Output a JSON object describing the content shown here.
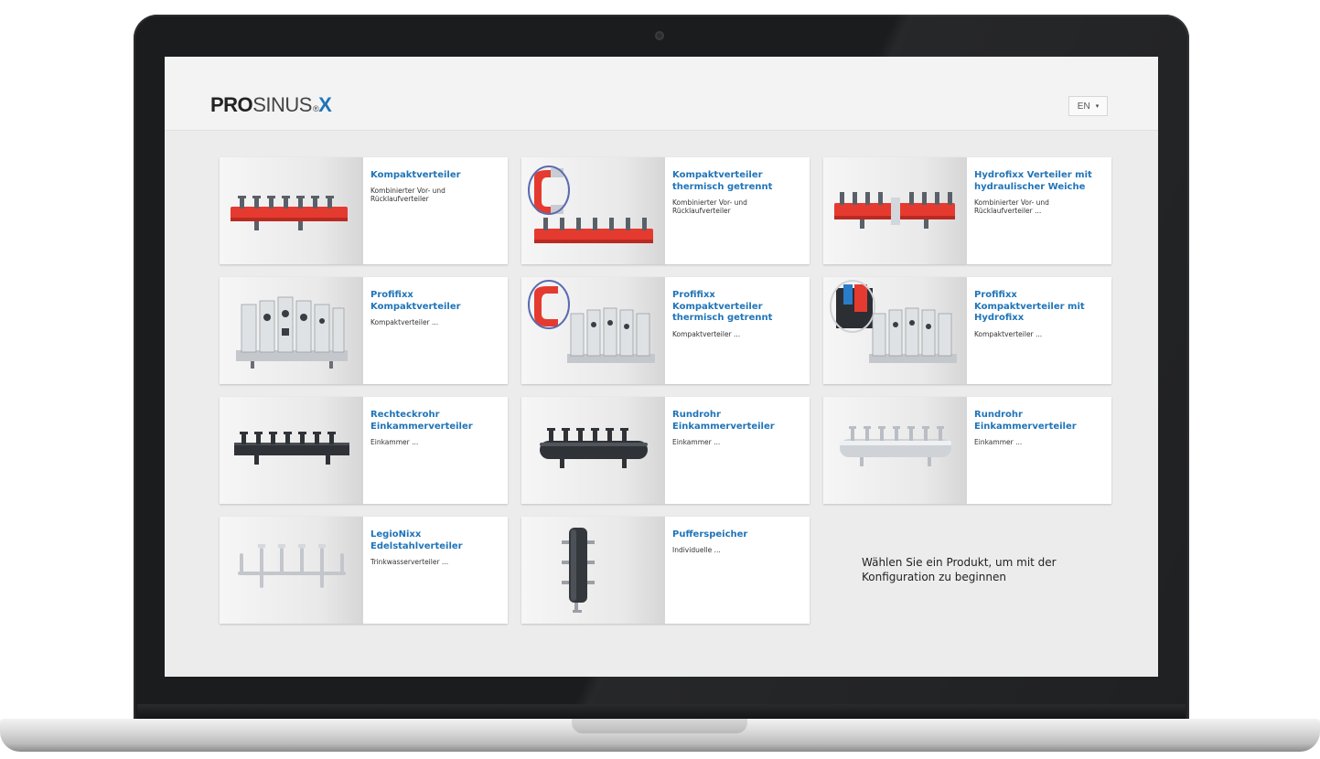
{
  "app": {
    "logo": {
      "part1": "PRO",
      "part2": "SINUS",
      "sup": "®",
      "part3": "X"
    },
    "language": {
      "selected": "EN",
      "caret": "▾"
    }
  },
  "products": [
    {
      "title": "Kompaktverteiler",
      "description": "Kombinierter Vor- und Rücklaufverteiler",
      "image": "red-compact-manifold"
    },
    {
      "title": "Kompaktverteiler thermisch getrennt",
      "description": "Kombinierter Vor- und Rücklaufverteiler",
      "image": "red-compact-manifold-with-thermal-separator"
    },
    {
      "title": "Hydrofixx Verteiler mit hydraulischer Weiche",
      "description": "Kombinierter Vor- und Rücklaufverteiler ...",
      "image": "red-manifold-with-hydraulic-separator"
    },
    {
      "title": "Profifixx Kompaktverteiler",
      "description": "Kompaktverteiler ...",
      "image": "steel-pump-group-manifold"
    },
    {
      "title": "Profifixx Kompaktverteiler thermisch getrennt",
      "description": "Kompaktverteiler ...",
      "image": "steel-pump-group-with-thermal-separator"
    },
    {
      "title": "Profifixx Kompaktverteiler mit Hydrofixx",
      "description": "Kompaktverteiler ...",
      "image": "steel-pump-group-with-hydrofixx"
    },
    {
      "title": "Rechteckrohr Einkammerverteiler",
      "description": "Einkammer ...",
      "image": "black-rectangular-manifold"
    },
    {
      "title": "Rundrohr Einkammerverteiler",
      "description": "Einkammer ...",
      "image": "black-round-manifold"
    },
    {
      "title": "Rundrohr Einkammerverteiler",
      "description": "Einkammer ...",
      "image": "stainless-round-manifold"
    },
    {
      "title": "LegioNixx Edelstahlverteiler",
      "description": "Trinkwasserverteiler ...",
      "image": "stainless-potable-water-manifold"
    },
    {
      "title": "Pufferspeicher",
      "description": "Individuelle ...",
      "image": "buffer-tank"
    }
  ],
  "prompt": "Wählen Sie ein Produkt, um mit der Konfiguration zu beginnen",
  "colors": {
    "accent": "#1f74b8",
    "background": "#ececec",
    "frame": "#1b1c1e"
  }
}
